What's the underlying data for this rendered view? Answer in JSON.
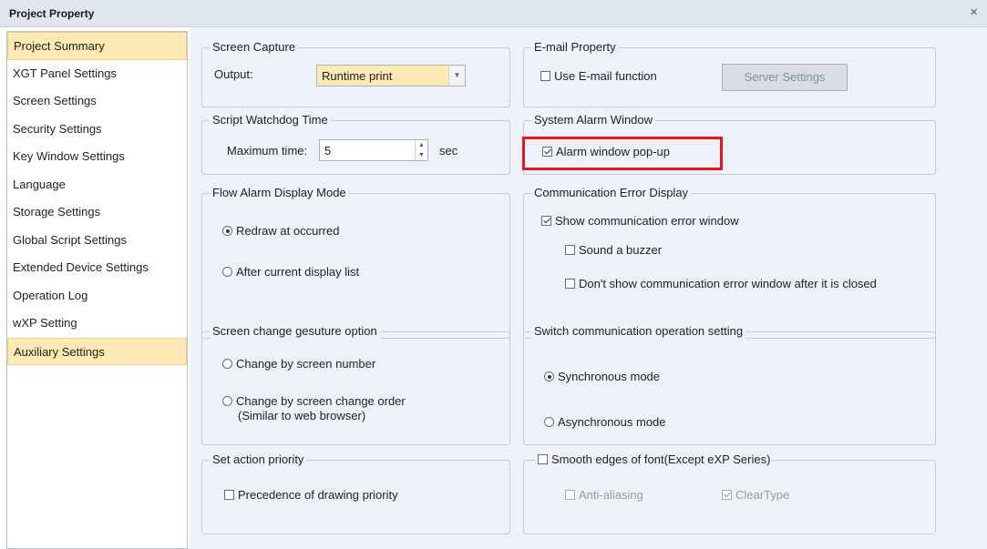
{
  "window": {
    "title": "Project Property",
    "close_glyph": "×"
  },
  "sidebar": {
    "items": [
      {
        "label": "Project Summary",
        "active": true
      },
      {
        "label": "XGT Panel Settings"
      },
      {
        "label": "Screen Settings"
      },
      {
        "label": "Security Settings"
      },
      {
        "label": "Key Window Settings"
      },
      {
        "label": "Language"
      },
      {
        "label": "Storage Settings"
      },
      {
        "label": "Global Script Settings"
      },
      {
        "label": "Extended Device Settings"
      },
      {
        "label": "Operation Log"
      },
      {
        "label": "wXP Setting"
      },
      {
        "label": "Auxiliary Settings",
        "active": true
      }
    ]
  },
  "screen_capture": {
    "legend": "Screen Capture",
    "output_label": "Output:",
    "output_value": "Runtime print",
    "dropdown_icon": "chevron-down-icon"
  },
  "email": {
    "legend": "E-mail Property",
    "use_label": "Use E-mail function",
    "use_checked": false,
    "server_button": "Server Settings"
  },
  "watchdog": {
    "legend": "Script Watchdog Time",
    "max_label": "Maximum time:",
    "value": "5",
    "unit": "sec"
  },
  "alarm_window": {
    "legend": "System Alarm Window",
    "popup_label": "Alarm window pop-up",
    "popup_checked": true,
    "highlight_color": "#e5161c"
  },
  "flow_alarm": {
    "legend": "Flow Alarm Display Mode",
    "options": [
      {
        "label": "Redraw at occurred",
        "selected": true
      },
      {
        "label": "After current display list",
        "selected": false
      }
    ]
  },
  "comm_error": {
    "legend": "Communication Error Display",
    "show_label": "Show communication error window",
    "show_checked": true,
    "buzzer_label": "Sound a buzzer",
    "buzzer_checked": false,
    "dont_show_label": "Don't show communication error window after it is closed",
    "dont_show_checked": false
  },
  "gesture": {
    "legend": "Screen change gesuture option",
    "options": [
      {
        "label": "Change by screen number",
        "selected": false
      },
      {
        "label": "Change by screen change order",
        "sublabel": "(Similar to web browser)",
        "selected": false
      }
    ]
  },
  "switch_comm": {
    "legend": "Switch communication operation setting",
    "options": [
      {
        "label": "Synchronous mode",
        "selected": true
      },
      {
        "label": "Asynchronous mode",
        "selected": false
      }
    ]
  },
  "action_priority": {
    "legend": "Set action priority",
    "precedence_label": "Precedence of drawing priority",
    "precedence_checked": false
  },
  "smooth_font": {
    "legend": "Smooth edges of font(Except eXP Series)",
    "legend_checked": false,
    "anti_aliasing_label": "Anti-aliasing",
    "anti_aliasing_checked": false,
    "cleartype_label": "ClearType",
    "cleartype_checked": true
  }
}
